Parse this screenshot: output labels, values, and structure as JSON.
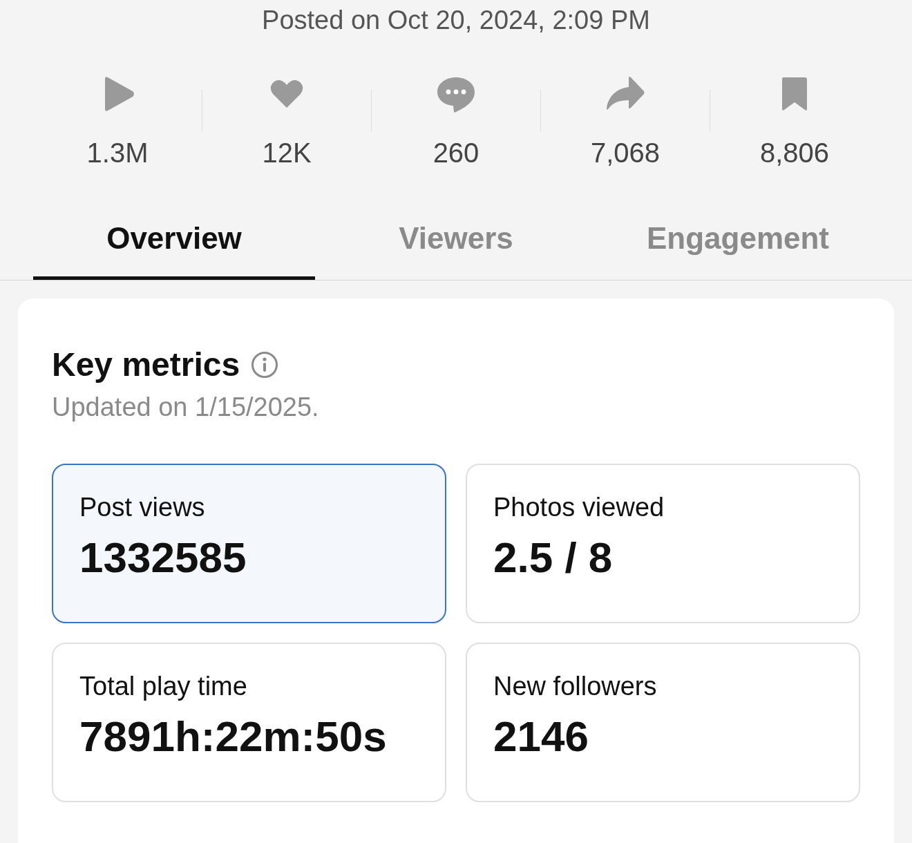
{
  "post_date": "Posted on Oct 20, 2024, 2:09 PM",
  "stats": [
    {
      "kind": "play",
      "value": "1.3M"
    },
    {
      "kind": "heart",
      "value": "12K"
    },
    {
      "kind": "comment",
      "value": "260"
    },
    {
      "kind": "share",
      "value": "7,068"
    },
    {
      "kind": "bookmark",
      "value": "8,806"
    }
  ],
  "tabs": [
    {
      "label": "Overview",
      "selected": true
    },
    {
      "label": "Viewers",
      "selected": false
    },
    {
      "label": "Engagement",
      "selected": false
    }
  ],
  "key_metrics": {
    "title": "Key metrics",
    "updated": "Updated on 1/15/2025.",
    "tiles": [
      {
        "label": "Post views",
        "value": "1332585",
        "selected": true
      },
      {
        "label": "Photos viewed",
        "value": "2.5 / 8",
        "selected": false
      },
      {
        "label": "Total play time",
        "value": "7891h:22m:50s",
        "selected": false
      },
      {
        "label": "New followers",
        "value": "2146",
        "selected": false
      }
    ]
  }
}
